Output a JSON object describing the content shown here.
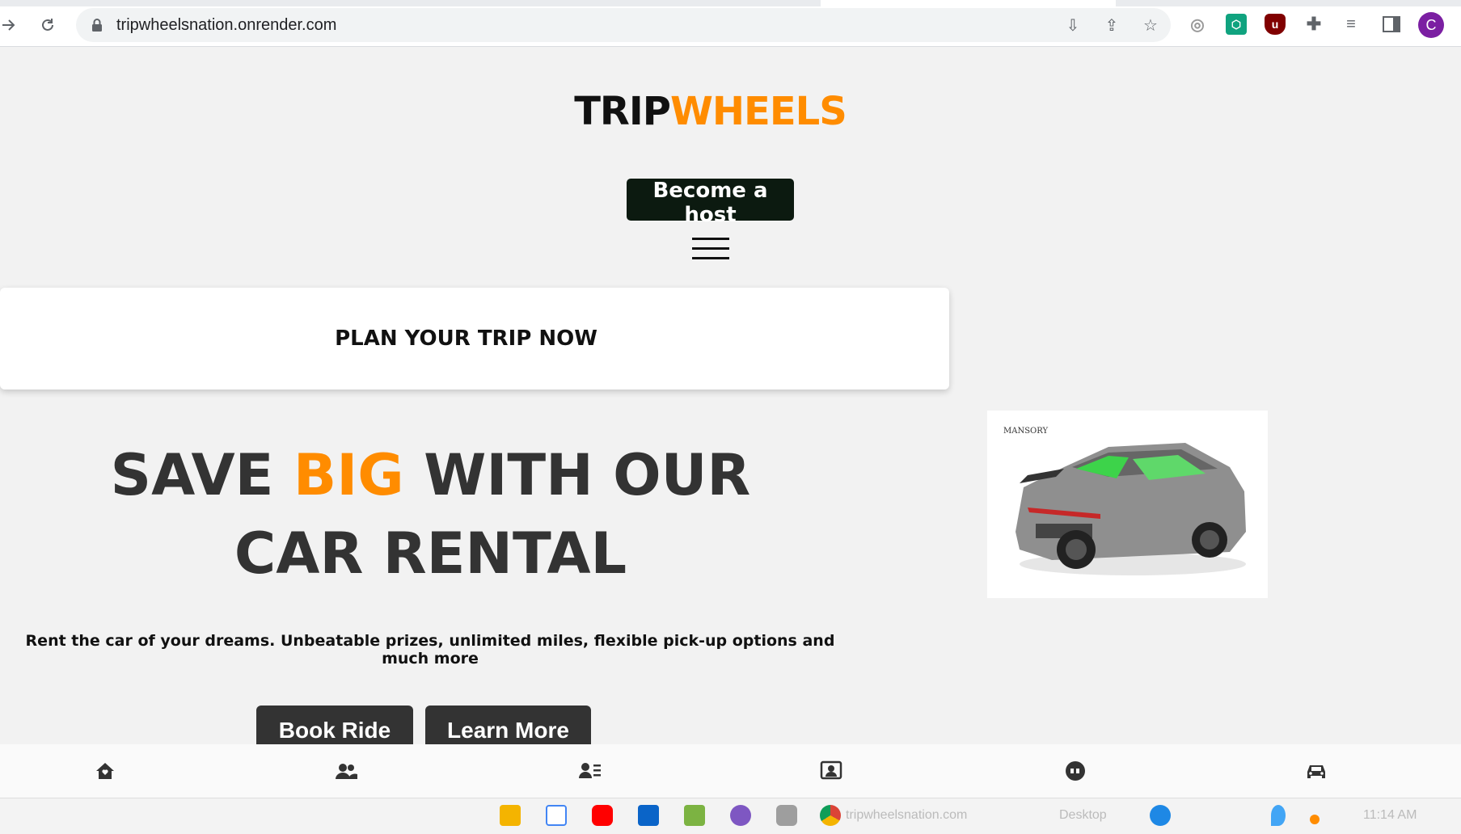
{
  "browser": {
    "url": "tripwheelsnation.onrender.com",
    "profile_initial": "C",
    "extensions": [
      "chatgpt-extension-icon",
      "ublock-origin-icon"
    ]
  },
  "site": {
    "logo_part1": "TRIP",
    "logo_part2": "WHEELS",
    "become_host_label": "Become a host",
    "plan_card_title": "PLAN YOUR TRIP NOW",
    "hero": {
      "line_part1": "SAVE ",
      "highlight": "BIG",
      "line_part2": " WITH OUR CAR RENTAL"
    },
    "tagline": "Rent the car of your dreams. Unbeatable prizes, unlimited miles, flexible pick-up options and much more",
    "book_label": "Book Ride",
    "learn_label": "Learn More",
    "car_image_brand": "MANSORY",
    "bottom_nav": [
      "home-icon",
      "users-icon",
      "user-list-icon",
      "contact-icon",
      "chat-icon",
      "car-icon"
    ],
    "accent_color": "#ff8c00"
  },
  "taskbar": {
    "desktop_label": "Desktop",
    "chrome_window_title": "tripwheelsnation.com",
    "time": "11:14 AM"
  }
}
